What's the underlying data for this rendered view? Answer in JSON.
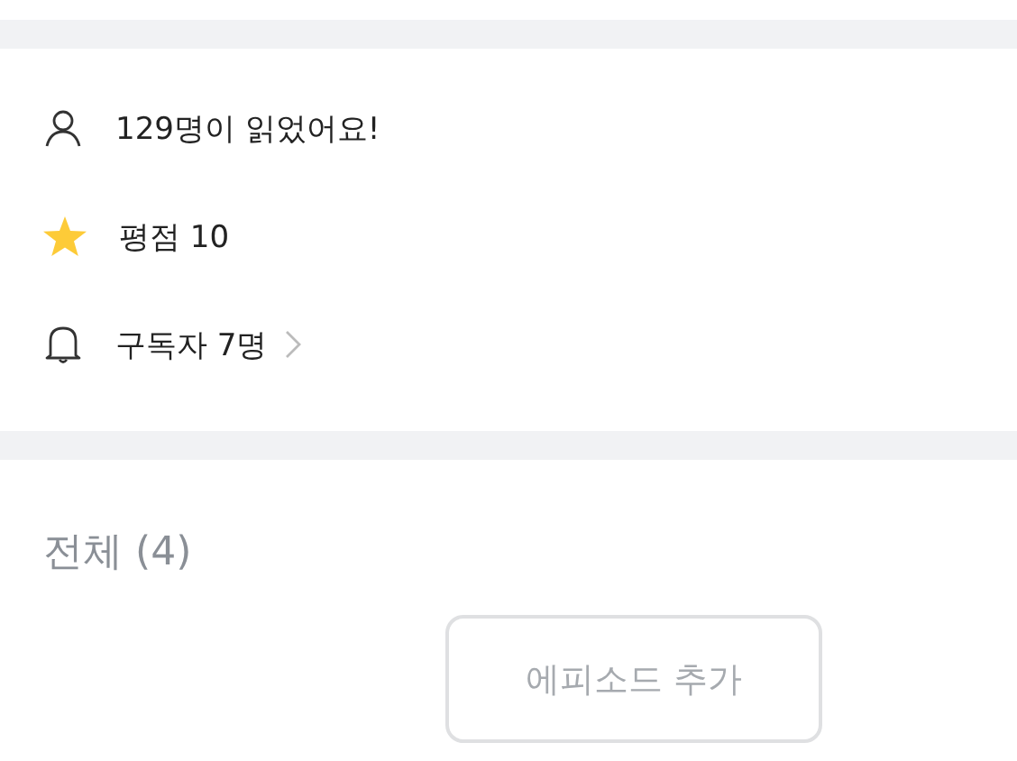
{
  "stats": [
    {
      "kind": "readers",
      "text": "129명이 읽었어요!"
    },
    {
      "kind": "rating",
      "text": "평점 10"
    },
    {
      "kind": "subscribers",
      "text": "구독자 7명"
    }
  ],
  "episodes": {
    "heading": "전체 (4)",
    "add_button": "에피소드 추가"
  }
}
